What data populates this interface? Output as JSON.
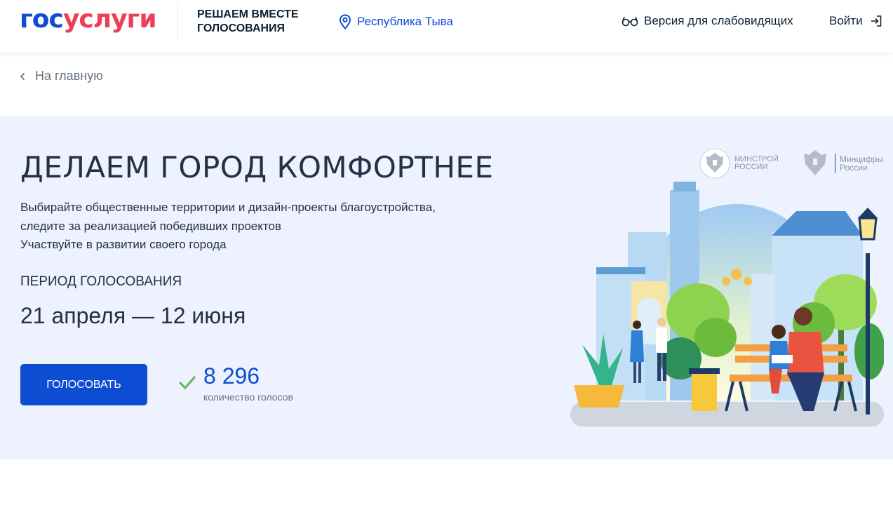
{
  "header": {
    "logo_part1": "гос",
    "logo_part2": "услуги",
    "project_title": "РЕШАЕМ ВМЕСТЕ ГОЛОСОВАНИЯ",
    "region": "Республика Тыва",
    "vision_mode": "Версия для слабовидящих",
    "login": "Войти"
  },
  "nav": {
    "back_label": "На главную"
  },
  "hero": {
    "title": "ДЕЛАЕМ ГОРОД КОМФОРТНЕЕ",
    "description": [
      "Выбирайте общественные территории и дизайн-проекты благоустройства,",
      "следите за реализацией победивших проектов",
      "Участвуйте в развитии своего города"
    ],
    "period_label": "ПЕРИОД ГОЛОСОВАНИЯ",
    "period": "21 апреля — 12 июня",
    "vote_button": "ГОЛОСОВАТЬ",
    "votes_count": "8 296",
    "votes_label": "количество голосов",
    "ministries": [
      {
        "line1": "МИНСТРОЙ",
        "line2": "РОССИИ"
      },
      {
        "line1": "Минцифры",
        "line2": "России"
      }
    ]
  },
  "colors": {
    "brand_blue": "#0d4cd3",
    "brand_red": "#ee3f58",
    "hero_bg": "#edf2fe",
    "text_dark": "#233145",
    "text_muted": "#66727f"
  },
  "icons": {
    "location": "map-pin-icon",
    "vision": "glasses-icon",
    "login": "login-arrow-icon",
    "back": "chevron-left-icon",
    "votes": "check-icon",
    "emblem": "coat-of-arms-icon"
  }
}
